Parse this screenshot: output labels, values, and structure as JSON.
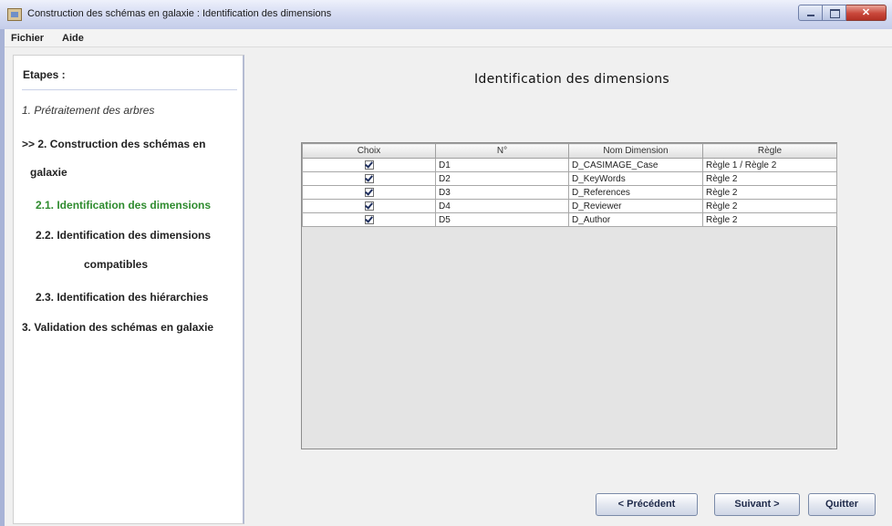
{
  "window": {
    "title": "Construction des schémas en galaxie : Identification des dimensions",
    "icon": "app-window-icon",
    "controls": [
      "minimize-icon",
      "maximize-icon",
      "close-icon"
    ]
  },
  "menu": {
    "items": [
      "Fichier",
      "Aide"
    ]
  },
  "sidebar": {
    "title": "Etapes :",
    "steps": [
      "1. Prétraitement des arbres",
      ">> 2. Construction des schémas en",
      "galaxie",
      "2.1. Identification des dimensions",
      "2.2. Identification des dimensions",
      "compatibles",
      "2.3. Identification des hiérarchies",
      "3. Validation des schémas en galaxie"
    ],
    "active_color": "#2e8b2e"
  },
  "main": {
    "title": "Identification des dimensions",
    "table": {
      "headers": [
        "Choix",
        "N°",
        "Nom Dimension",
        "Règle"
      ],
      "rows": [
        {
          "checked": true,
          "num": "D1",
          "name": "D_CASIMAGE_Case",
          "rule": "Règle 1 / Règle 2"
        },
        {
          "checked": true,
          "num": "D2",
          "name": "D_KeyWords",
          "rule": "Règle 2"
        },
        {
          "checked": true,
          "num": "D3",
          "name": "D_References",
          "rule": "Règle 2"
        },
        {
          "checked": true,
          "num": "D4",
          "name": "D_Reviewer",
          "rule": "Règle 2"
        },
        {
          "checked": true,
          "num": "D5",
          "name": "D_Author",
          "rule": "Règle 2"
        }
      ]
    }
  },
  "buttons": {
    "previous": "< Précédent",
    "next": "Suivant >",
    "quit": "Quitter"
  }
}
